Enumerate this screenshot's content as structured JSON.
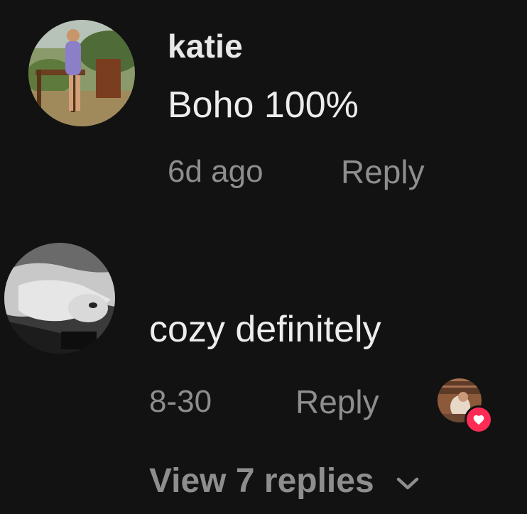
{
  "comments": [
    {
      "username": "katie",
      "text": "Boho 100%",
      "time": "6d ago",
      "reply_label": "Reply"
    },
    {
      "username": "",
      "text": "cozy definitely",
      "time": "8-30",
      "reply_label": "Reply",
      "liked_by_creator": true,
      "view_replies_label": "View 7 replies"
    }
  ],
  "icons": {
    "liked_badge": "heart-icon",
    "expand_replies": "chevron-down-icon"
  },
  "colors": {
    "background": "#121212",
    "primary_text": "#ededed",
    "secondary_text": "#8e8e8e",
    "like_badge": "#fe2c55"
  }
}
